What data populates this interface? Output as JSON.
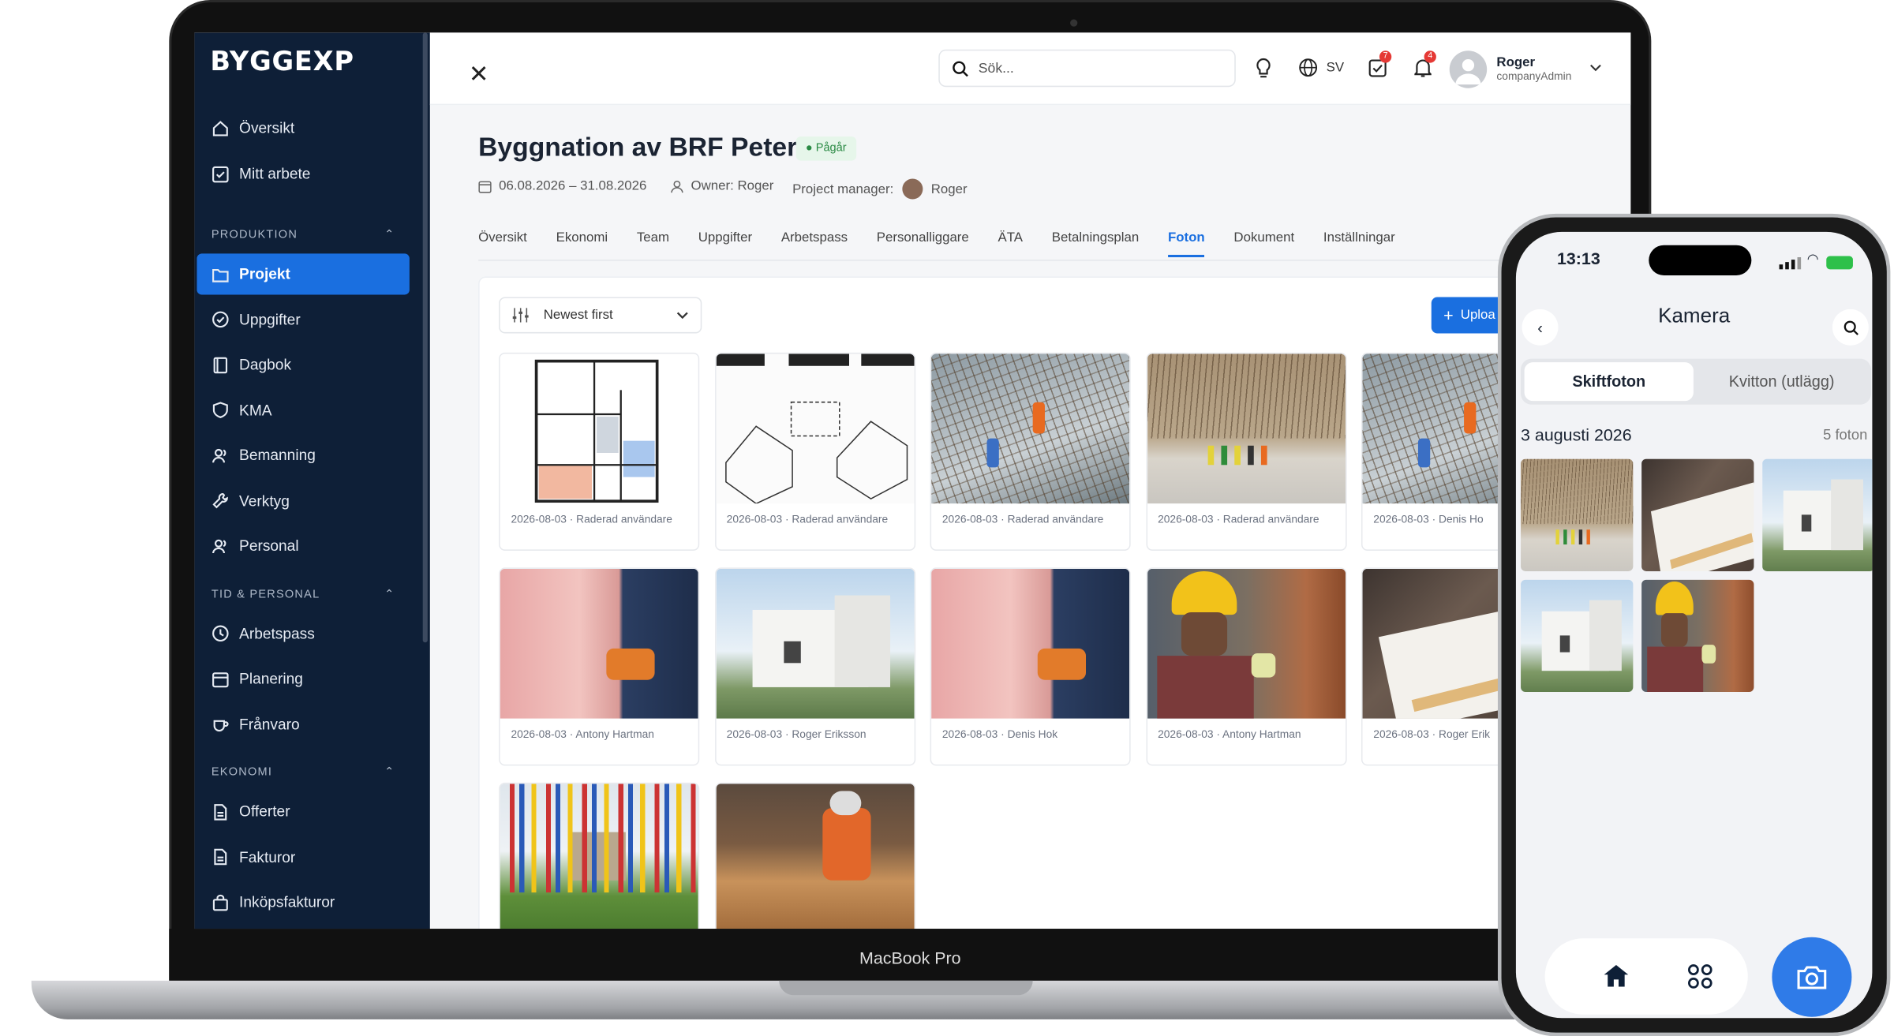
{
  "device": {
    "laptop_label": "MacBook Pro"
  },
  "sidebar": {
    "logo": "BYGGEXP",
    "top_items": [
      {
        "label": "Översikt",
        "icon": "home-icon"
      },
      {
        "label": "Mitt arbete",
        "icon": "checkbox-icon"
      }
    ],
    "sections": [
      {
        "title": "PRODUKTION",
        "items": [
          "Projekt",
          "Uppgifter",
          "Dagbok",
          "KMA",
          "Bemanning",
          "Verktyg",
          "Personal"
        ]
      },
      {
        "title": "TID & PERSONAL",
        "items": [
          "Arbetspass",
          "Planering",
          "Frånvaro"
        ]
      },
      {
        "title": "EKONOMI",
        "items": [
          "Offerter",
          "Fakturor",
          "Inköpsfakturor"
        ]
      }
    ],
    "active_item": "Projekt"
  },
  "topbar": {
    "search_placeholder": "Sök...",
    "language": "SV",
    "tasks_badge": "7",
    "notifications_badge": "4",
    "user_name": "Roger",
    "user_role": "companyAdmin"
  },
  "project": {
    "title": "Byggnation av BRF Peter",
    "status": "Pågår",
    "dates": "06.08.2026 – 31.08.2026",
    "owner": "Owner: Roger",
    "pm_label": "Project manager:",
    "pm_name": "Roger"
  },
  "tabs": [
    "Översikt",
    "Ekonomi",
    "Team",
    "Uppgifter",
    "Arbetspass",
    "Personalliggare",
    "ÄTA",
    "Betalningsplan",
    "Foton",
    "Dokument",
    "Inställningar"
  ],
  "active_tab": "Foton",
  "photos_toolbar": {
    "sort_label": "Newest first",
    "upload_label": "Uploa"
  },
  "photos": [
    {
      "caption": "2026-08-03 · Raderad användare",
      "kind": "floorplan"
    },
    {
      "caption": "2026-08-03 · Raderad användare",
      "kind": "sketch"
    },
    {
      "caption": "2026-08-03 · Raderad användare",
      "kind": "rebar"
    },
    {
      "caption": "2026-08-03 · Raderad användare",
      "kind": "site"
    },
    {
      "caption": "2026-08-03 · Denis Ho",
      "kind": "rebar"
    },
    {
      "caption": "2026-08-03 · Antony Hartman",
      "kind": "insulation"
    },
    {
      "caption": "2026-08-03 · Roger Eriksson",
      "kind": "house"
    },
    {
      "caption": "2026-08-03 · Denis Hok",
      "kind": "insulation"
    },
    {
      "caption": "2026-08-03 · Antony Hartman",
      "kind": "worker"
    },
    {
      "caption": "2026-08-03 · Roger Erik",
      "kind": "plans"
    },
    {
      "caption": "",
      "kind": "flags"
    },
    {
      "caption": "",
      "kind": "timber"
    }
  ],
  "phone": {
    "time": "13:13",
    "title": "Kamera",
    "segments": [
      "Skiftfoton",
      "Kvitton (utlägg)"
    ],
    "date_label": "3 augusti 2026",
    "count_label": "5 foton",
    "thumbs": [
      "site",
      "plans",
      "house",
      "house",
      "worker"
    ]
  },
  "colors": {
    "accent": "#1a6fe0",
    "sidebar": "#0e1f37",
    "status_bg": "#e6f6ea",
    "status_text": "#2a8a44"
  }
}
